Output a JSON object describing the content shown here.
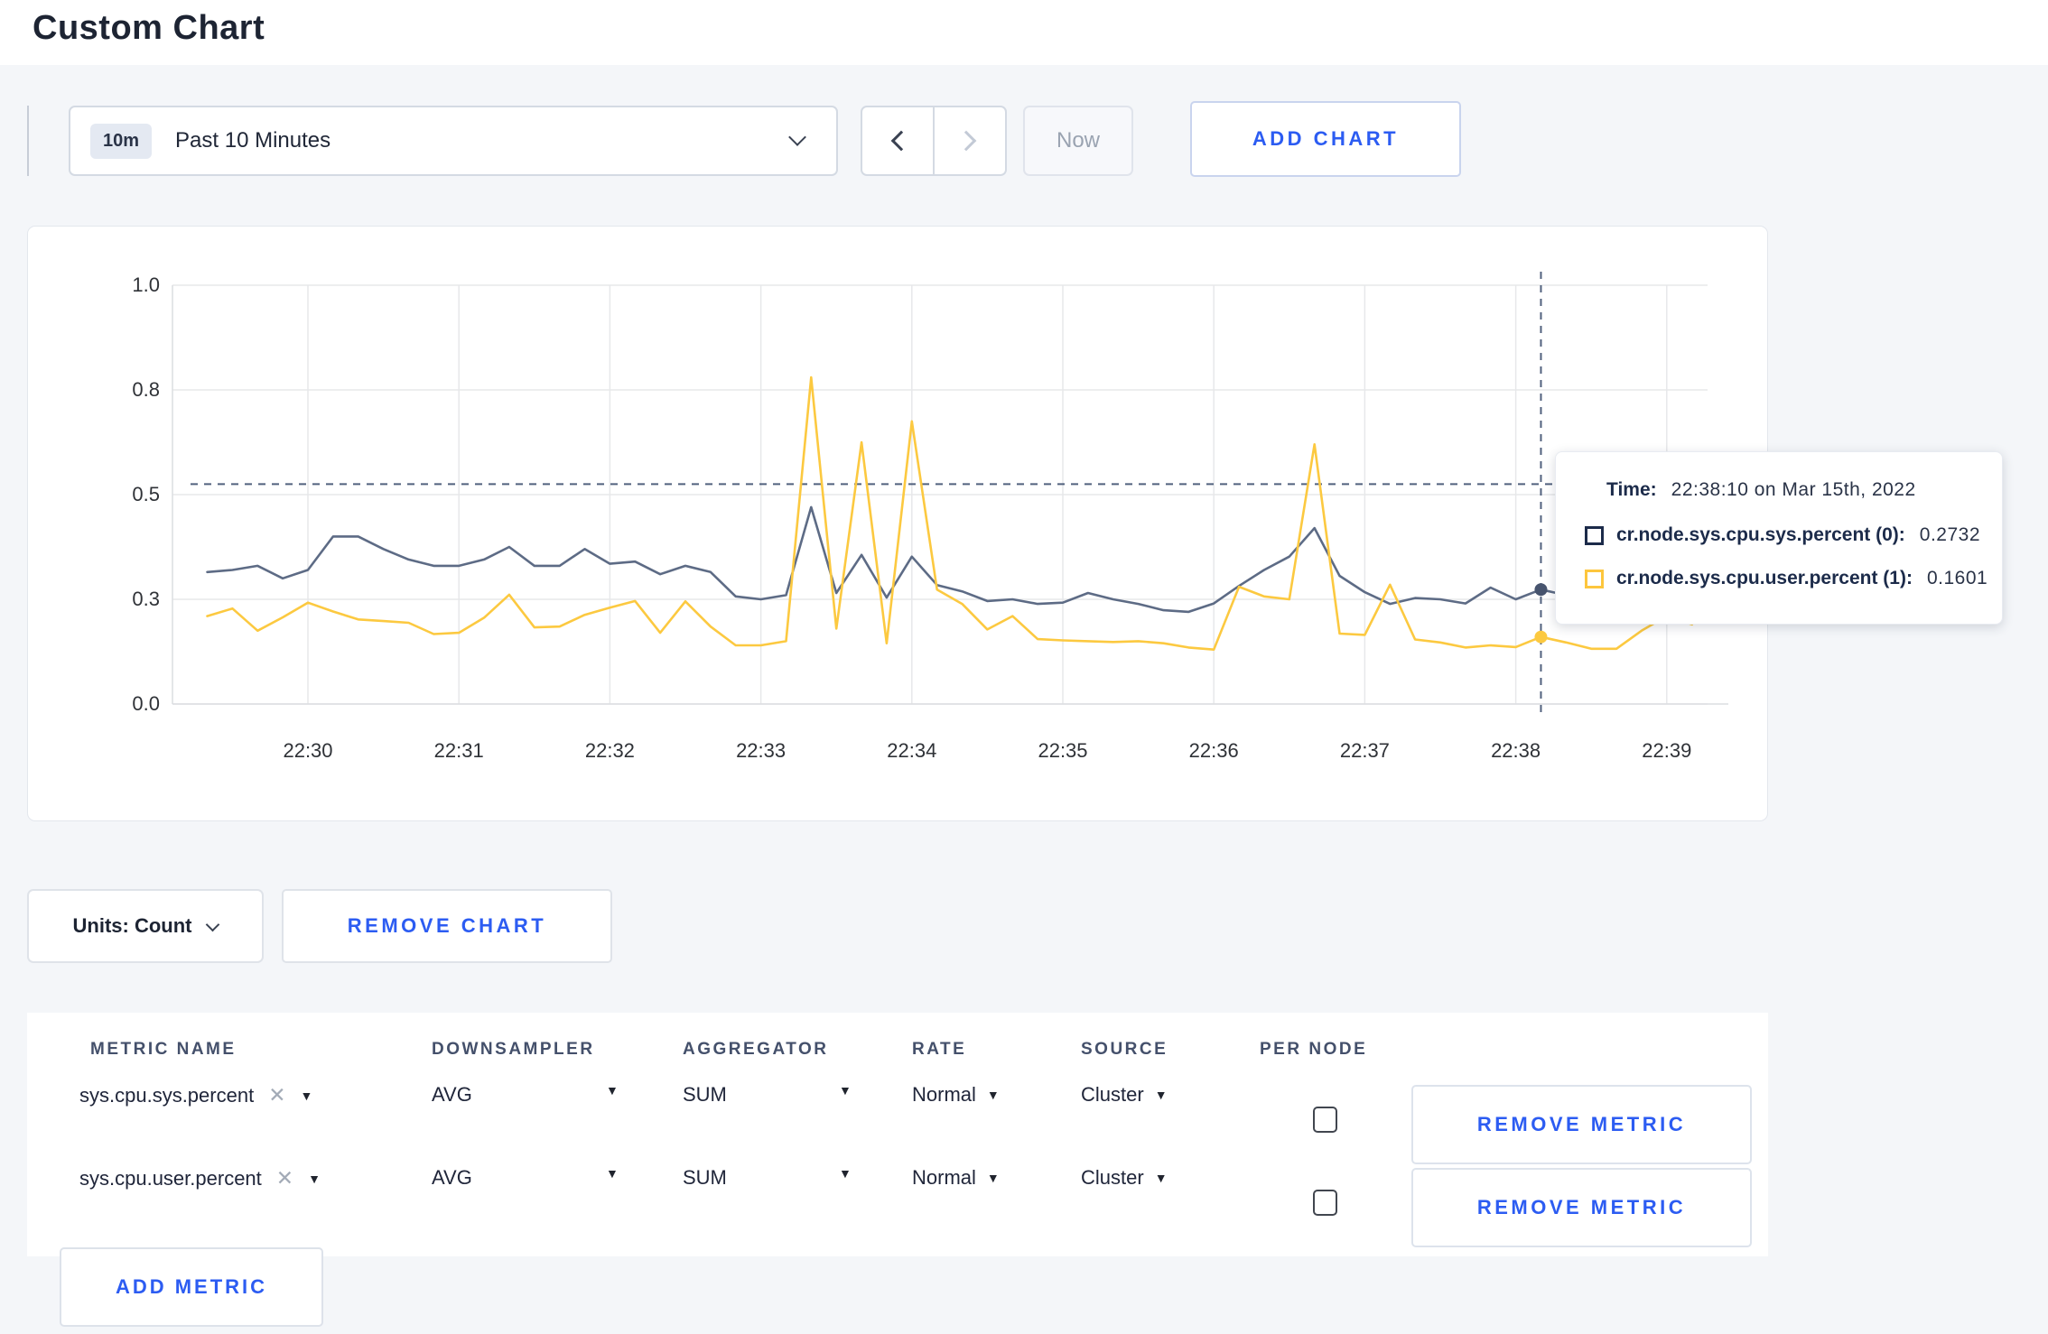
{
  "page": {
    "title": "Custom Chart"
  },
  "toolbar": {
    "range_badge": "10m",
    "range_label": "Past 10 Minutes",
    "now_label": "Now",
    "add_chart_label": "ADD CHART"
  },
  "chart": {
    "units_label": "Units: Count",
    "remove_chart_label": "REMOVE CHART"
  },
  "tooltip": {
    "time_label": "Time:",
    "time_value": "22:38:10 on Mar 15th, 2022",
    "series": [
      {
        "label": "cr.node.sys.cpu.sys.percent (0):",
        "value": "0.2732",
        "color": "#1c2b4a"
      },
      {
        "label": "cr.node.sys.cpu.user.percent (1):",
        "value": "0.1601",
        "color": "#fdc63d"
      }
    ]
  },
  "metrics_table": {
    "headers": [
      "METRIC NAME",
      "DOWNSAMPLER",
      "AGGREGATOR",
      "RATE",
      "SOURCE",
      "PER NODE"
    ],
    "rows": [
      {
        "name": "sys.cpu.sys.percent",
        "downsampler": "AVG",
        "aggregator": "SUM",
        "rate": "Normal",
        "source": "Cluster",
        "per_node_checked": false
      },
      {
        "name": "sys.cpu.user.percent",
        "downsampler": "AVG",
        "aggregator": "SUM",
        "rate": "Normal",
        "source": "Cluster",
        "per_node_checked": false
      }
    ],
    "remove_metric_label": "REMOVE METRIC",
    "add_metric_label": "ADD METRIC"
  },
  "chart_data": {
    "type": "line",
    "title": "",
    "xlabel": "",
    "ylabel": "",
    "ylim": [
      0,
      1
    ],
    "grid": true,
    "x_tick_labels": [
      "22:30",
      "22:31",
      "22:32",
      "22:33",
      "22:34",
      "22:35",
      "22:36",
      "22:37",
      "22:38",
      "22:39"
    ],
    "y_ticks": [
      {
        "label": "0.0",
        "value": 0
      },
      {
        "label": "0.3",
        "value": 0.25
      },
      {
        "label": "0.5",
        "value": 0.5
      },
      {
        "label": "0.8",
        "value": 0.75
      },
      {
        "label": "1.0",
        "value": 1.0
      }
    ],
    "start_offset_sec": -40,
    "step_sec": 10,
    "series": [
      {
        "name": "cr.node.sys.cpu.sys.percent",
        "color": "#5d6b85",
        "values": [
          0.315,
          0.32,
          0.33,
          0.3,
          0.32,
          0.4,
          0.4,
          0.37,
          0.345,
          0.33,
          0.33,
          0.345,
          0.375,
          0.33,
          0.33,
          0.37,
          0.335,
          0.34,
          0.31,
          0.33,
          0.315,
          0.257,
          0.25,
          0.26,
          0.47,
          0.265,
          0.356,
          0.254,
          0.352,
          0.284,
          0.269,
          0.246,
          0.25,
          0.239,
          0.242,
          0.265,
          0.25,
          0.239,
          0.224,
          0.22,
          0.24,
          0.282,
          0.32,
          0.352,
          0.42,
          0.306,
          0.267,
          0.239,
          0.253,
          0.25,
          0.24,
          0.278,
          0.25,
          0.2732,
          0.26,
          0.27,
          0.27,
          0.275,
          0.28,
          0.28
        ]
      },
      {
        "name": "cr.node.sys.cpu.user.percent",
        "color": "#fcc940",
        "values": [
          0.21,
          0.228,
          0.175,
          0.207,
          0.242,
          0.221,
          0.202,
          0.198,
          0.194,
          0.167,
          0.17,
          0.206,
          0.261,
          0.183,
          0.185,
          0.213,
          0.23,
          0.246,
          0.17,
          0.245,
          0.185,
          0.14,
          0.14,
          0.15,
          0.78,
          0.18,
          0.625,
          0.145,
          0.675,
          0.273,
          0.239,
          0.178,
          0.21,
          0.155,
          0.152,
          0.15,
          0.148,
          0.15,
          0.145,
          0.135,
          0.13,
          0.28,
          0.257,
          0.25,
          0.62,
          0.168,
          0.165,
          0.285,
          0.154,
          0.147,
          0.135,
          0.14,
          0.136,
          0.1601,
          0.147,
          0.132,
          0.132,
          0.175,
          0.21,
          0.19
        ]
      }
    ],
    "crosshair": {
      "time": "22:38:10",
      "point_index": 53,
      "hline_value": 0.525,
      "dot_values": [
        0.2732,
        0.1601
      ]
    }
  }
}
